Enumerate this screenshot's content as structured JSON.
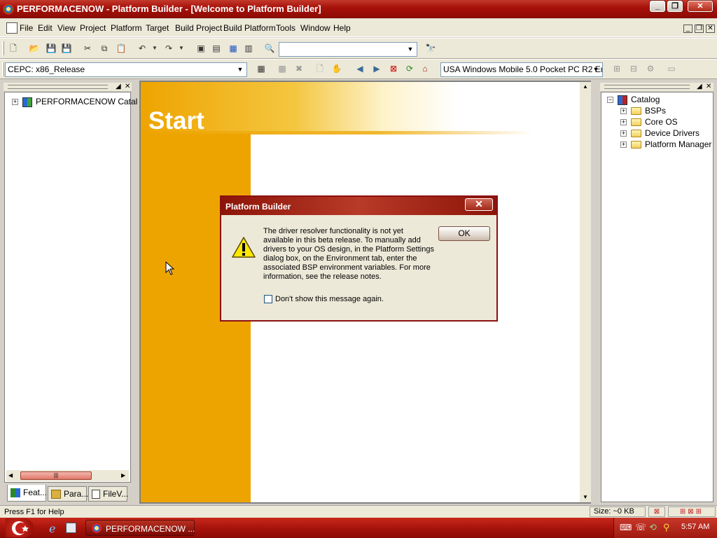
{
  "window": {
    "title": "PERFORMACENOW - Platform Builder - [Welcome to Platform Builder]"
  },
  "menu": [
    "File",
    "Edit",
    "View",
    "Project",
    "Platform",
    "Target",
    "Build Project",
    "Build Platform",
    "Tools",
    "Window",
    "Help"
  ],
  "toolbar": {
    "find_combo_value": "",
    "config_combo_value": "CEPC: x86_Release",
    "sdk_combo_value": "USA Windows Mobile 5.0 Pocket PC R2 Em"
  },
  "left_pane": {
    "tree_root": "PERFORMACENOW Catal",
    "tabs": [
      "Feat...",
      "Para...",
      "FileV..."
    ]
  },
  "welcome": {
    "heading": "Start"
  },
  "catalog": {
    "root": "Catalog",
    "items": [
      "BSPs",
      "Core OS",
      "Device Drivers",
      "Platform Manager"
    ]
  },
  "dialog": {
    "title": "Platform Builder",
    "message_lines": [
      "The driver resolver functionality is not yet",
      "available in this beta release. To manually add",
      "drivers to your OS design, in the Platform Settings",
      "dialog box, on the Environment tab, enter the",
      "associated BSP environment variables. For more",
      "information, see the release notes."
    ],
    "ok_label": "OK",
    "checkbox_label": "Don't show this message again.",
    "checkbox_checked": false
  },
  "statusbar": {
    "help_text": "Press F1 for Help",
    "size_text": "Size: ~0 KB"
  },
  "taskbar": {
    "task_label": "PERFORMACENOW ...",
    "clock": "5:57 AM"
  },
  "colors": {
    "title_red": "#a8120a",
    "welcome_orange": "#eea400",
    "dialog_border": "#8c1010"
  },
  "icons": [
    "app-icon",
    "minimize-icon",
    "maximize-icon",
    "close-icon",
    "new-file-icon",
    "open-folder-icon",
    "save-icon",
    "save-all-icon",
    "cut-icon",
    "copy-icon",
    "paste-icon",
    "undo-icon",
    "redo-icon",
    "warning-icon",
    "folder-icon",
    "start-button-icon",
    "ie-icon"
  ]
}
